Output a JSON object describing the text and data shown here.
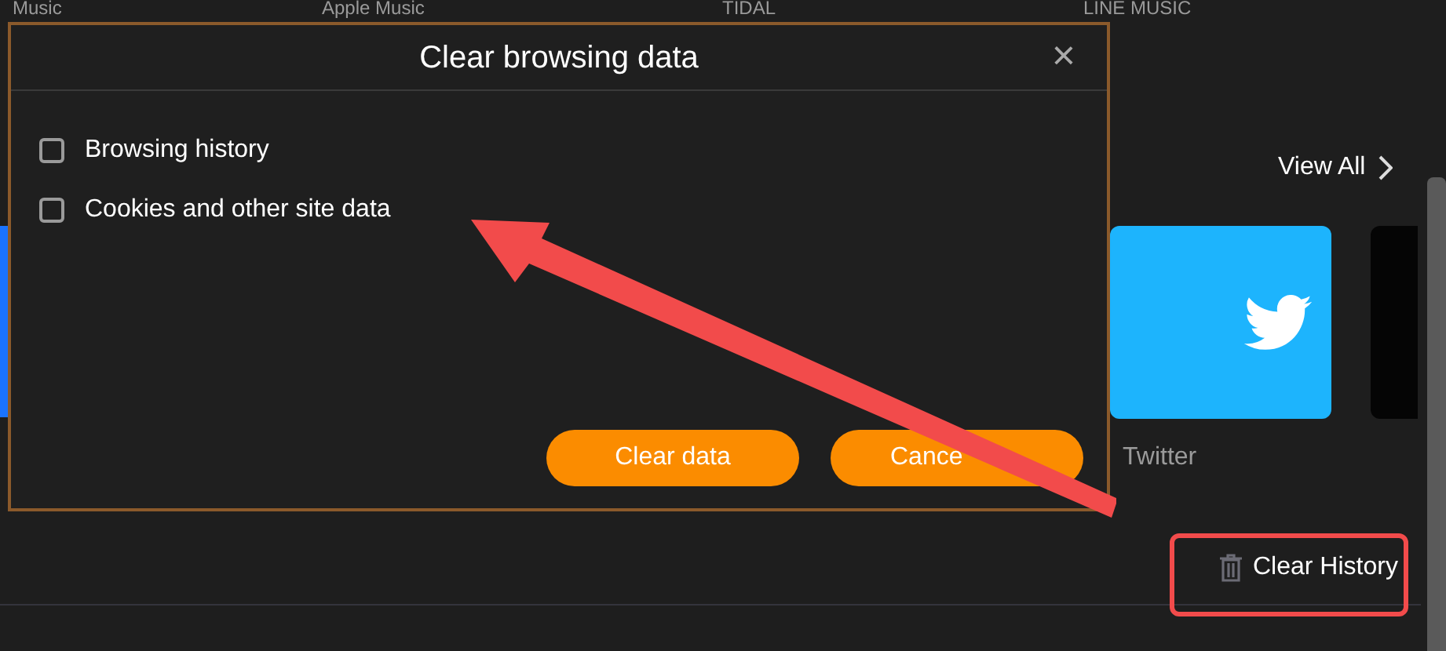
{
  "background_labels": [
    "Music",
    "Apple Music",
    "TIDAL",
    "LINE MUSIC"
  ],
  "view_all": "View All",
  "apps": [
    {
      "label": "Twitter"
    }
  ],
  "clear_history": "Clear History",
  "dialog": {
    "title": "Clear browsing data",
    "close": "×",
    "options": [
      {
        "label": "Browsing history",
        "checked": false
      },
      {
        "label": "Cookies and other site data",
        "checked": false
      }
    ],
    "buttons": [
      "Clear data",
      "Cance"
    ]
  }
}
